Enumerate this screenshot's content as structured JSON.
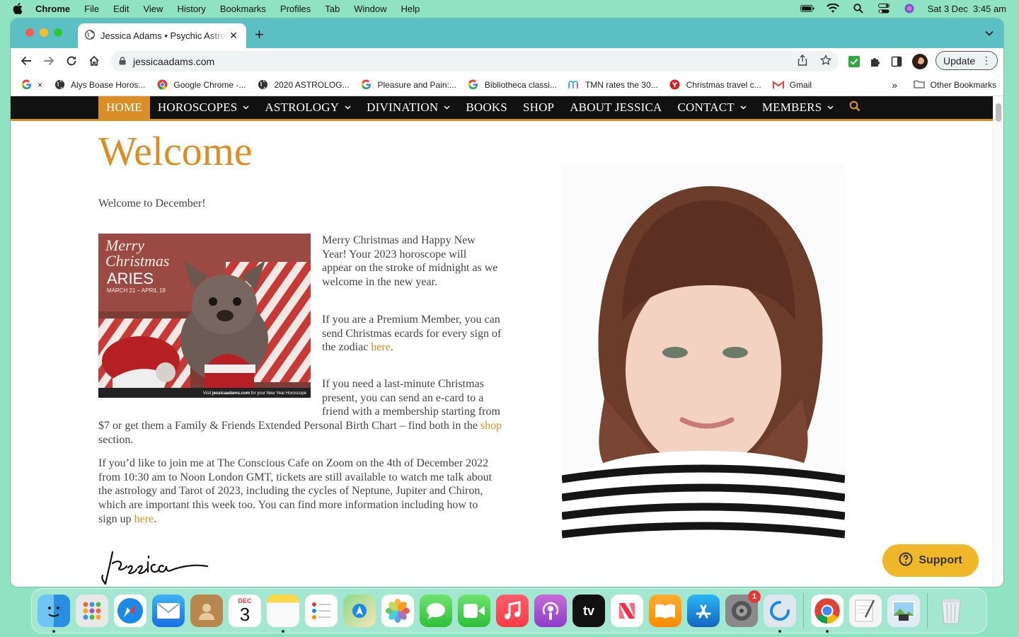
{
  "menubar": {
    "app": "Chrome",
    "items": [
      "File",
      "Edit",
      "View",
      "History",
      "Bookmarks",
      "Profiles",
      "Tab",
      "Window",
      "Help"
    ],
    "datetime": "Sat 3 Dec  3:45 am"
  },
  "tab": {
    "title": "Jessica Adams • Psychic Astrology"
  },
  "address": {
    "url": "jessicaadams.com"
  },
  "update_label": "Update",
  "bookmarks": [
    {
      "label": "×",
      "icon": "google-icon"
    },
    {
      "label": "Alys Boase Horos...",
      "icon": "globe-icon"
    },
    {
      "label": "Google Chrome -...",
      "icon": "chrome-icon"
    },
    {
      "label": "2020 ASTROLOG...",
      "icon": "globe-icon"
    },
    {
      "label": "Pleasure and Pain:...",
      "icon": "google-icon"
    },
    {
      "label": "Bibliotheca classi...",
      "icon": "google-icon"
    },
    {
      "label": "TMN rates the 30...",
      "icon": "tmn-icon"
    },
    {
      "label": "Christmas travel c...",
      "icon": "yelp-icon"
    },
    {
      "label": "Gmail",
      "icon": "gmail-icon"
    }
  ],
  "other_bookmarks": "Other Bookmarks",
  "site_nav": [
    {
      "label": "HOME",
      "dropdown": false
    },
    {
      "label": "HOROSCOPES",
      "dropdown": true
    },
    {
      "label": "ASTROLOGY",
      "dropdown": true
    },
    {
      "label": "DIVINATION",
      "dropdown": true
    },
    {
      "label": "BOOKS",
      "dropdown": false
    },
    {
      "label": "SHOP",
      "dropdown": false
    },
    {
      "label": "ABOUT JESSICA",
      "dropdown": false
    },
    {
      "label": "CONTACT",
      "dropdown": true
    },
    {
      "label": "MEMBERS",
      "dropdown": true
    }
  ],
  "content": {
    "heading": "Welcome",
    "intro": "Welcome to December!",
    "puppy_image": {
      "line1": "Merry",
      "line2": "Christmas",
      "sign": "ARIES",
      "dates": "MARCH 21 – APRIL 19",
      "footer_pre": "Visit ",
      "footer_site": "jessicaadams.com",
      "footer_post": " for your New Year Horoscope"
    },
    "para1": "Merry Christmas and Happy New Year! Your 2023 horoscope will appear on the stroke of midnight as we welcome in the new year.",
    "para2_pre": "If you are a Premium Member, you can send Christmas ecards for every sign of the zodiac ",
    "para2_link": "here",
    "para2_post": ".",
    "para3_pre": "If you need a last-minute Christmas present, you can send an e-card to a friend with a membership starting from $7 or get them a Family & Friends Extended Personal Birth Chart – find both in the ",
    "para3_link": "shop",
    "para3_post": " section.",
    "para4_pre": "If you’d like to join me at The Conscious Cafe on Zoom on the 4th of December 2022 from 10:30 am to Noon London GMT, tickets are still available to watch me talk about the astrology and Tarot of 2023, including the cycles of Neptune, Jupiter and Chiron, which are important this week too. You can find more information including how to sign up ",
    "para4_link": "here",
    "para4_post": ".",
    "signature": "Jessica"
  },
  "support_label": "Support",
  "dock": {
    "calendar_month": "DEC",
    "calendar_day": "3",
    "settings_badge": "1",
    "tv_label": "tv"
  },
  "colors": {
    "accent": "#d98e27",
    "nav_bg": "#111111",
    "tab_bar": "#5cbfc4",
    "desktop": "#8fe3c2",
    "support": "#f1b72b"
  }
}
